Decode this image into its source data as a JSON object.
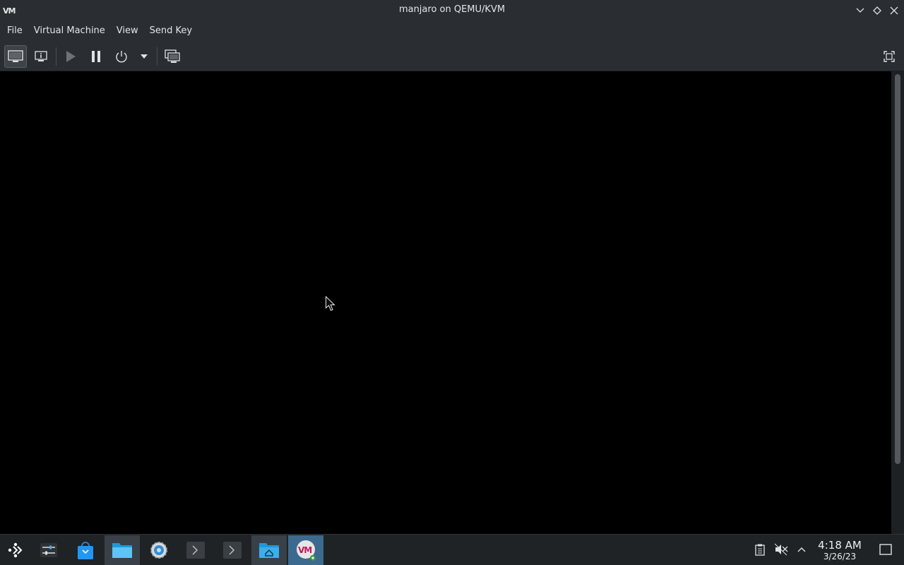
{
  "window": {
    "title": "manjaro on QEMU/KVM",
    "app_icon": "virt-manager-icon",
    "controls": [
      "minimize-icon",
      "maximize-icon",
      "close-icon"
    ]
  },
  "menubar": {
    "items": [
      "File",
      "Virtual Machine",
      "View",
      "Send Key"
    ]
  },
  "toolbar": {
    "buttons": [
      {
        "icon": "console-monitor-icon",
        "active": true
      },
      {
        "icon": "details-info-icon",
        "active": false
      },
      {
        "icon": "run-play-icon",
        "active": false,
        "disabled": true
      },
      {
        "icon": "pause-icon",
        "active": false
      },
      {
        "icon": "power-icon",
        "active": false
      },
      {
        "icon": "chevron-down-icon",
        "active": false
      },
      {
        "icon": "snapshots-icon",
        "active": false
      },
      {
        "icon": "fullscreen-icon",
        "active": false
      }
    ]
  },
  "display": {
    "background": "#000000"
  },
  "taskbar": {
    "launcher_icon": "application-launcher-icon",
    "tasks": [
      {
        "icon": "system-settings-sliders-icon",
        "state": "normal"
      },
      {
        "icon": "software-store-bag-icon",
        "state": "normal"
      },
      {
        "icon": "file-manager-folder-icon",
        "state": "open"
      },
      {
        "icon": "system-settings-gear-icon",
        "state": "normal"
      },
      {
        "icon": "terminal-icon",
        "state": "normal"
      },
      {
        "icon": "terminal-icon",
        "state": "normal"
      },
      {
        "icon": "home-folder-icon",
        "state": "open"
      },
      {
        "icon": "virt-manager-icon",
        "state": "active"
      }
    ],
    "tray_icons": [
      "clipboard-icon",
      "volume-muted-icon",
      "chevron-up-icon"
    ],
    "clock": {
      "time": "4:18 AM",
      "date": "3/26/23"
    },
    "show_desktop_icon": "show-desktop-icon"
  },
  "colors": {
    "chrome": "#2a2e32",
    "taskbar": "#1f2326",
    "active_task": "#3c6a8e",
    "text": "#e3e5e7"
  }
}
